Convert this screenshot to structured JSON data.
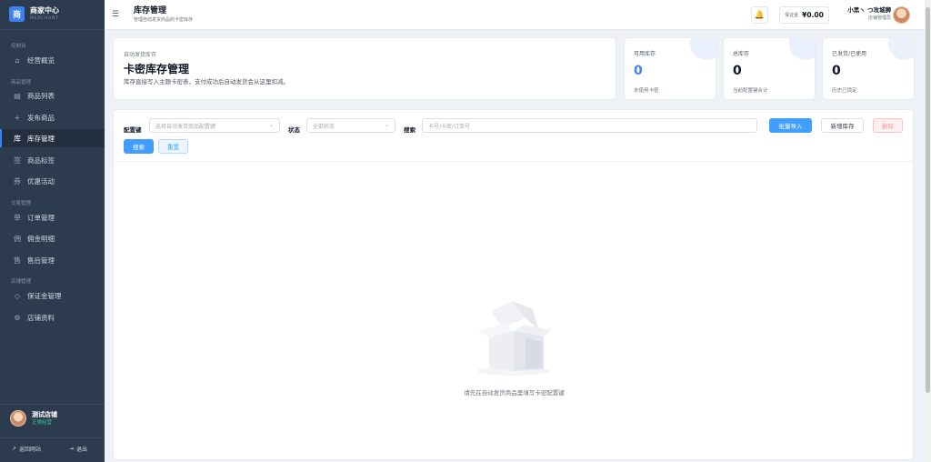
{
  "sidebar": {
    "brand_logo": "商",
    "brand_title": "商家中心",
    "brand_sub": "MERCHANT",
    "groups": [
      {
        "title": "控制台"
      },
      {
        "title": "商品管理"
      },
      {
        "title": "交易管理"
      },
      {
        "title": "店铺管理"
      }
    ],
    "items": [
      {
        "label": "经营概览",
        "icon": "home-icon",
        "glyph": "⌂"
      },
      {
        "label": "商品列表",
        "icon": "list-icon",
        "glyph": "▤"
      },
      {
        "label": "发布商品",
        "icon": "plus-icon",
        "glyph": "+"
      },
      {
        "label": "库存管理",
        "icon": "warehouse-icon",
        "glyph": "库"
      },
      {
        "label": "商品标签",
        "icon": "tag-icon",
        "glyph": "签"
      },
      {
        "label": "优惠活动",
        "icon": "coupon-icon",
        "glyph": "券"
      },
      {
        "label": "订单管理",
        "icon": "order-icon",
        "glyph": "单"
      },
      {
        "label": "佣金明细",
        "icon": "commission-icon",
        "glyph": "佣"
      },
      {
        "label": "售后管理",
        "icon": "aftersale-icon",
        "glyph": "售"
      },
      {
        "label": "保证金管理",
        "icon": "diamond-icon",
        "glyph": "◇"
      },
      {
        "label": "店铺资料",
        "icon": "settings-icon",
        "glyph": "⚙"
      }
    ],
    "active_item": "库存管理",
    "store_name": "测试店铺",
    "store_status": "正常经营",
    "back_link": "返回网站",
    "logout": "退出"
  },
  "topbar": {
    "title": "库存管理",
    "subtitle": "管理自动发货商品的卡密库存",
    "deposit_label": "保证金",
    "deposit_value": "¥0.00",
    "user_name": "小黑ヽ つ攻城狮",
    "user_role": "店铺管理员"
  },
  "hero": {
    "eyebrow": "自动发货库存",
    "title": "卡密库存管理",
    "desc": "库存直接写入主题卡密表，支付成功后自动发货会从这里扣减。"
  },
  "stats": [
    {
      "label": "可用库存",
      "value": "0",
      "note": "未使用卡密",
      "accent": "#3b82f6"
    },
    {
      "label": "总库存",
      "value": "0",
      "note": "当前配置键合计"
    },
    {
      "label": "已发货/已使用",
      "value": "0",
      "note": "历史已锁定"
    }
  ],
  "filters": {
    "config_label": "配置键",
    "config_placeholder": "选择自动发货商品配置键",
    "status_label": "状态",
    "status_value": "全部状态",
    "search_label": "搜索",
    "search_placeholder": "卡号/卡密/订单号",
    "btn_import": "批量导入",
    "btn_new": "新增库存",
    "btn_delete": "删除",
    "btn_search": "搜索",
    "btn_reset": "重置"
  },
  "empty": {
    "text": "请先在自动发货商品里填写卡密配置键"
  },
  "colors": {
    "sidebar_bg": "#2d3b4f",
    "primary": "#409eff",
    "accent_blue": "#3b82f6",
    "warning": "#f59e0b",
    "success": "#34d399"
  }
}
